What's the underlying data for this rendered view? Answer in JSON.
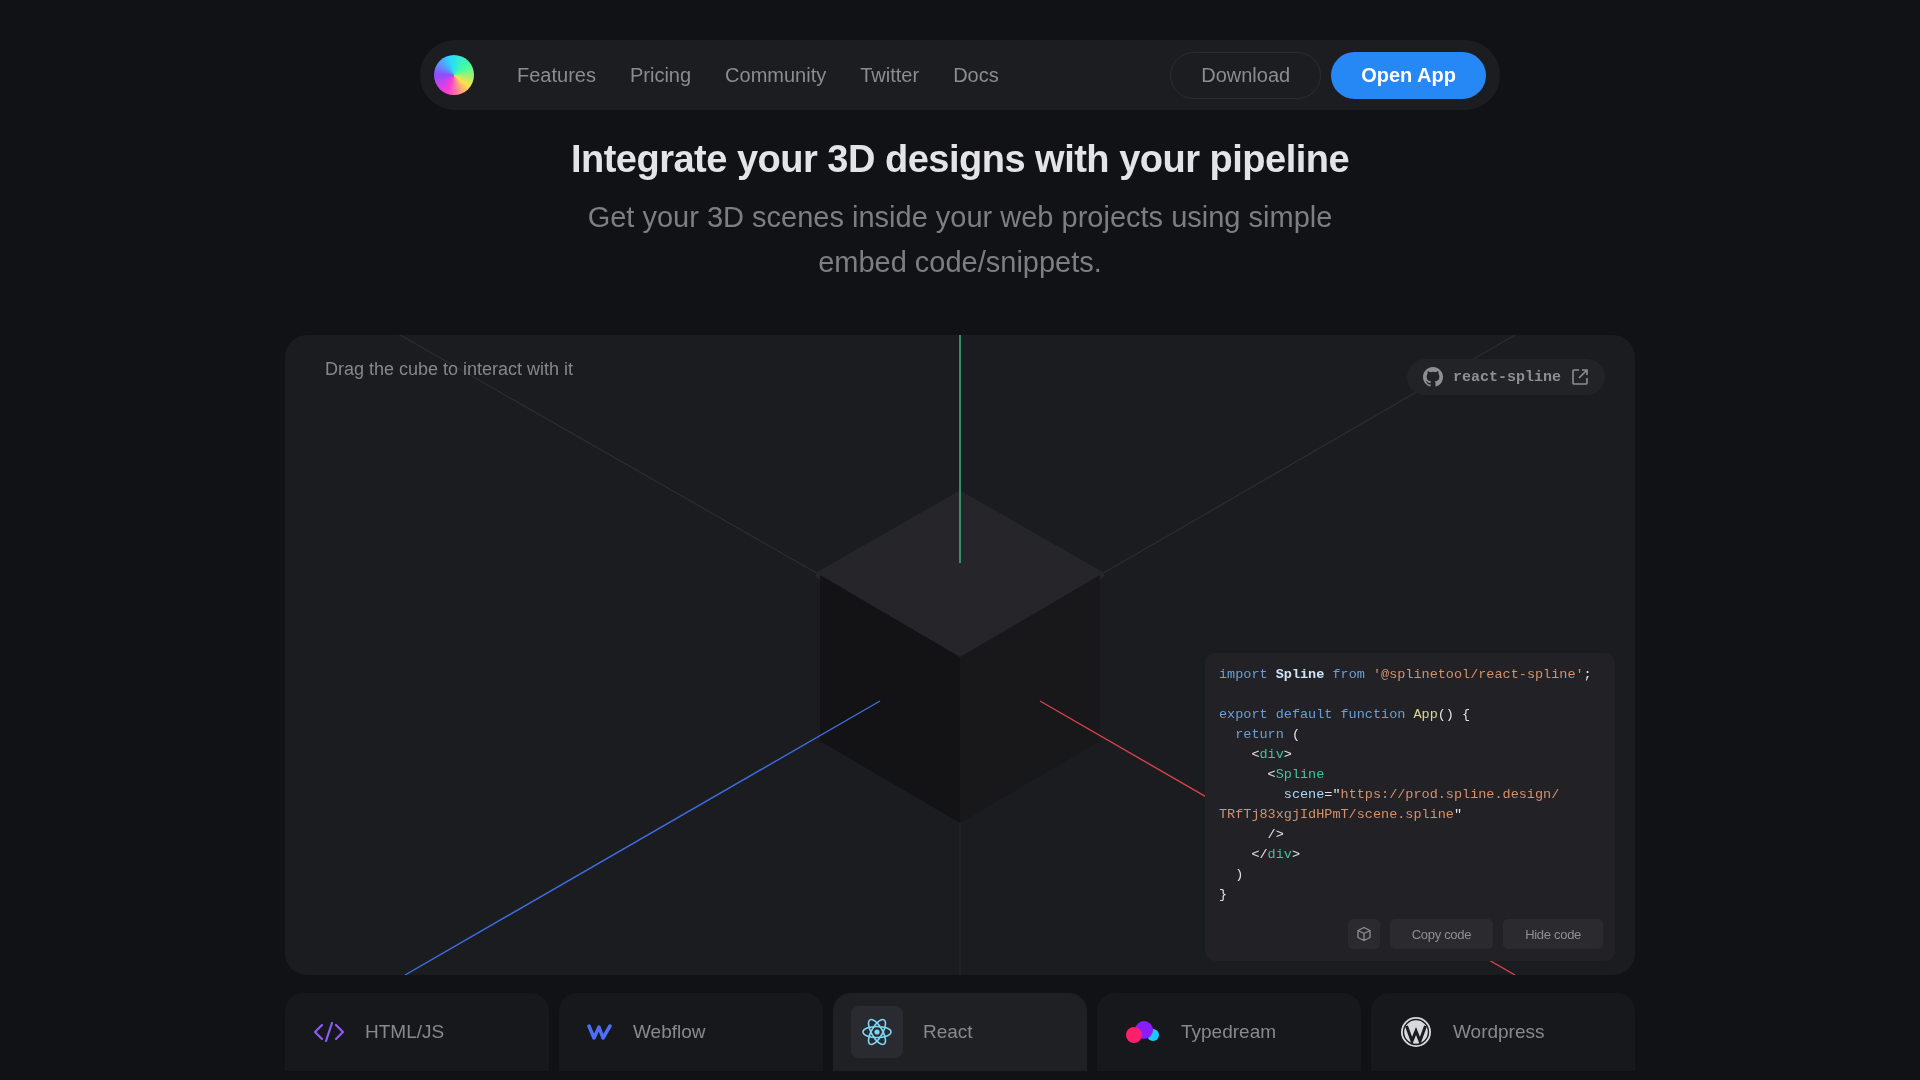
{
  "nav": {
    "links": [
      {
        "label": "Features"
      },
      {
        "label": "Pricing"
      },
      {
        "label": "Community"
      },
      {
        "label": "Twitter"
      },
      {
        "label": "Docs"
      }
    ],
    "download": "Download",
    "open_app": "Open App"
  },
  "hero": {
    "title": "Integrate your 3D designs with your pipeline",
    "subtitle": "Get your 3D scenes inside your web projects using simple embed code/snippets."
  },
  "scene": {
    "hint": "Drag the cube to interact with it",
    "repo_link": "react-spline",
    "code": {
      "lines": [
        {
          "tokens": [
            {
              "text": "import ",
              "kind": "kw"
            },
            {
              "text": "Spline ",
              "kind": "ident"
            },
            {
              "text": "from ",
              "kind": "kw"
            },
            {
              "text": "'@splinetool/react-spline'",
              "kind": "str"
            },
            {
              "text": ";",
              "kind": "punct"
            }
          ]
        },
        {
          "spaced": true,
          "tokens": [
            {
              "text": "export default function ",
              "kind": "kw"
            },
            {
              "text": "App",
              "kind": "fn"
            },
            {
              "text": "() {",
              "kind": "punct"
            }
          ]
        },
        {
          "tokens": [
            {
              "text": "  return ",
              "kind": "kw"
            },
            {
              "text": "(",
              "kind": "punct"
            }
          ]
        },
        {
          "tokens": [
            {
              "text": "    <",
              "kind": "punct"
            },
            {
              "text": "div",
              "kind": "tag"
            },
            {
              "text": ">",
              "kind": "punct"
            }
          ]
        },
        {
          "tokens": [
            {
              "text": "      <",
              "kind": "punct"
            },
            {
              "text": "Spline",
              "kind": "tag"
            }
          ]
        },
        {
          "tokens": [
            {
              "text": "        scene",
              "kind": "attr"
            },
            {
              "text": "=\"",
              "kind": "punct"
            },
            {
              "text": "https://prod.spline.design/",
              "kind": "str"
            }
          ]
        },
        {
          "tokens": [
            {
              "text": "TRfTj83xgjIdHPmT/scene.spline",
              "kind": "str"
            },
            {
              "text": "\"",
              "kind": "punct"
            }
          ]
        },
        {
          "tokens": [
            {
              "text": "      />",
              "kind": "punct"
            }
          ]
        },
        {
          "tokens": [
            {
              "text": "    </",
              "kind": "punct"
            },
            {
              "text": "div",
              "kind": "tag"
            },
            {
              "text": ">",
              "kind": "punct"
            }
          ]
        },
        {
          "tokens": [
            {
              "text": "  )",
              "kind": "punct"
            }
          ]
        },
        {
          "tokens": [
            {
              "text": "}",
              "kind": "punct"
            }
          ]
        }
      ],
      "copy_button": "Copy code",
      "hide_button": "Hide code"
    }
  },
  "platforms": [
    {
      "label": "HTML/JS",
      "kind": "code",
      "selected": false
    },
    {
      "label": "Webflow",
      "kind": "zigzag",
      "selected": false
    },
    {
      "label": "React",
      "kind": "atom",
      "selected": true
    },
    {
      "label": "Typedream",
      "kind": "blobs",
      "selected": false
    },
    {
      "label": "Wordpress",
      "kind": "circle",
      "selected": false
    }
  ]
}
